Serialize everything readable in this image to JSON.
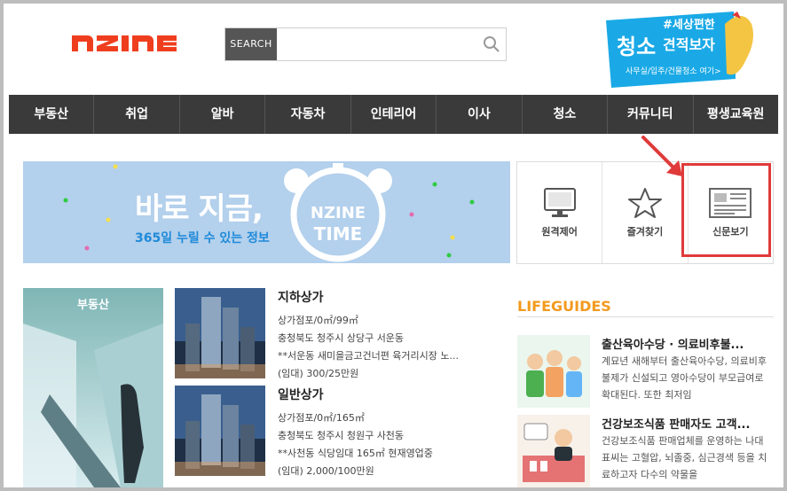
{
  "header": {
    "logo_text": "NZINE",
    "search_label": "SEARCH",
    "search_placeholder": "",
    "ad": {
      "hashtag": "#세상편한",
      "big": "청소",
      "title": "견적보자",
      "sub": "사무실/입주/건물청소 여기>"
    }
  },
  "nav": [
    "부동산",
    "취업",
    "알바",
    "자동차",
    "인테리어",
    "이사",
    "청소",
    "커뮤니티",
    "평생교육원"
  ],
  "time_banner": {
    "headline": "바로 지금,",
    "subline": "365일 누릴 수 있는 정보",
    "clock_line1": "NZINE",
    "clock_line2": "TIME"
  },
  "tiles": [
    {
      "label": "원격제어",
      "icon": "monitor-icon"
    },
    {
      "label": "즐겨찾기",
      "icon": "star-icon"
    },
    {
      "label": "신문보기",
      "icon": "newspaper-icon"
    }
  ],
  "category_label": "부동산",
  "listings": [
    {
      "title": "지하상가",
      "type": "상가점포/0㎡/99㎡",
      "location": "충청북도 청주시 상당구 서운동",
      "desc": "**서운동 새미을금고건너편 육거리시장 노...",
      "price": "(임대) 300/25만원"
    },
    {
      "title": "일반상가",
      "type": "상가점포/0㎡/165㎡",
      "location": "충청북도 청주시 청원구 사천동",
      "desc": "**사천동 식당임대 165㎡ 현재영업중",
      "price": "(임대) 2,000/100만원"
    }
  ],
  "lifeguides": {
    "title": "LIFEGUIDES",
    "items": [
      {
        "headline": "출산육아수당 · 의료비후불...",
        "text": "계묘년 새해부터 출산육아수당, 의료비후불제가 신설되고 영아수당이 부모급여로 확대된다. 또한 최저임"
      },
      {
        "headline": "건강보조식품 판매자도 고객...",
        "text": "건강보조식품 판매업체를 운영하는 나대표씨는 고혈압, 뇌졸중, 심근경색 등을 치료하고자 다수의 약물을"
      }
    ]
  },
  "colors": {
    "logo": "#ef3e1e",
    "nav_bg": "#3a3a3a",
    "banner_bg": "#b3d0ec",
    "accent_orange": "#f29a1e",
    "highlight_red": "#e03a3a"
  }
}
